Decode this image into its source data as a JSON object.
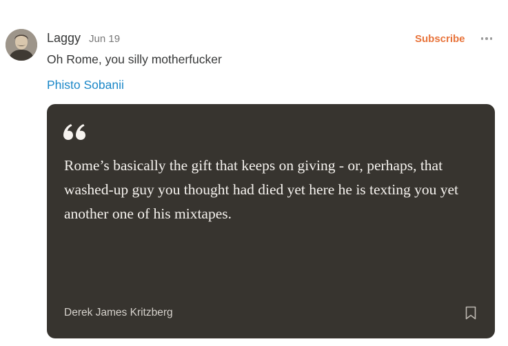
{
  "note": {
    "author": "Laggy",
    "date": "Jun 19",
    "body": "Oh Rome, you silly motherfucker",
    "mention": "Phisto Sobanii"
  },
  "actions": {
    "subscribe_label": "Subscribe",
    "more_icon": "more-horizontal-icon"
  },
  "quote_card": {
    "text": "Rome’s basically the gift that keeps on giving - or, perhaps, that washed-up guy you thought had died yet here he is texting you yet another one of his mixtapes.",
    "author": "Derek James Kritzberg",
    "quote_icon": "quote-icon",
    "bookmark_icon": "bookmark-icon"
  },
  "colors": {
    "accent": "#e8733a",
    "link": "#1a87c8",
    "card_background": "#37342f",
    "card_text": "#f6f3ef"
  }
}
